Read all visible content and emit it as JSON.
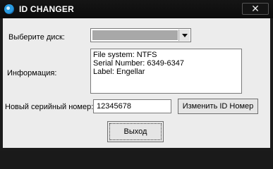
{
  "window": {
    "title": "ID CHANGER",
    "close_glyph": "✕"
  },
  "form": {
    "disk_label": "Выберите диск:",
    "disk_selected": "",
    "info_label": "Информация:",
    "info_lines": [
      "File system: NTFS",
      "Serial Number: 6349-6347",
      "Label: Engellar"
    ],
    "serial_label": "Новый серийный номер:",
    "serial_value": "12345678",
    "change_button": "Изменить ID Номер",
    "exit_button": "Выход"
  }
}
